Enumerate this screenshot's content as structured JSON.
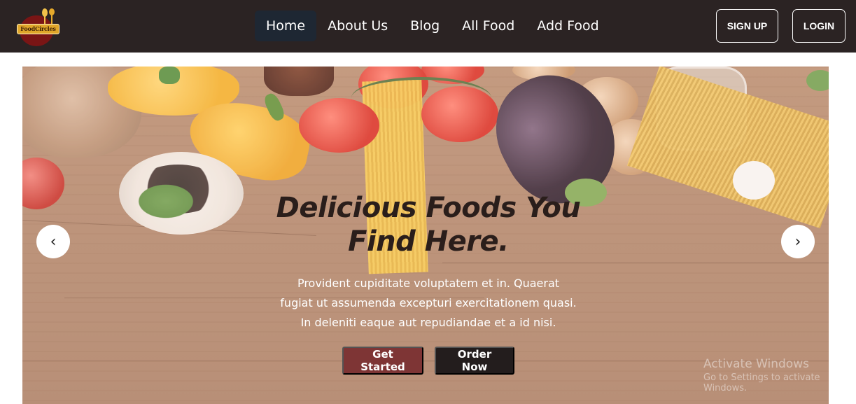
{
  "brand": {
    "logo_text": "FoodCircles"
  },
  "nav": {
    "items": [
      {
        "label": "Home",
        "active": true
      },
      {
        "label": "About Us",
        "active": false
      },
      {
        "label": "Blog",
        "active": false
      },
      {
        "label": "All Food",
        "active": false
      },
      {
        "label": "Add Food",
        "active": false
      }
    ],
    "signup_label": "SIGN UP",
    "login_label": "LOGIN"
  },
  "hero": {
    "title": "Delicious Foods You Find Here.",
    "description": "Provident cupiditate voluptatem et in. Quaerat fugiat ut assumenda excepturi exercitationem quasi. In deleniti eaque aut repudiandae et a id nisi.",
    "primary_button": "Get Started",
    "secondary_button": "Order Now",
    "prev_glyph": "‹",
    "next_glyph": "›"
  },
  "watermark": {
    "line1": "Activate Windows",
    "line2": "Go to Settings to activate Windows."
  },
  "colors": {
    "navbar_bg": "#2b2323",
    "active_nav_bg": "#1e2733",
    "primary_button": "#7e3535",
    "secondary_button": "#231d1d"
  }
}
